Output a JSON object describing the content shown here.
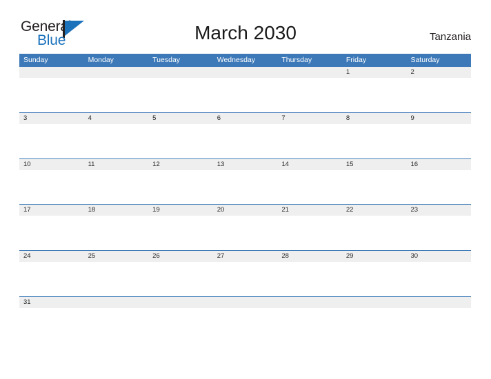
{
  "brand": {
    "name_part1": "General",
    "name_part2": "Blue",
    "mark": "flag-triangle"
  },
  "header": {
    "title": "March 2030",
    "locale": "Tanzania"
  },
  "colors": {
    "header_blue": "#3d79b8",
    "logo_blue": "#1b72bb",
    "daynum_band": "#efefef",
    "text": "#262626"
  },
  "calendar": {
    "month": "March",
    "year": "2030",
    "weekday_headers": [
      "Sunday",
      "Monday",
      "Tuesday",
      "Wednesday",
      "Thursday",
      "Friday",
      "Saturday"
    ],
    "weeks": [
      [
        "",
        "",
        "",
        "",
        "",
        "1",
        "2"
      ],
      [
        "3",
        "4",
        "5",
        "6",
        "7",
        "8",
        "9"
      ],
      [
        "10",
        "11",
        "12",
        "13",
        "14",
        "15",
        "16"
      ],
      [
        "17",
        "18",
        "19",
        "20",
        "21",
        "22",
        "23"
      ],
      [
        "24",
        "25",
        "26",
        "27",
        "28",
        "29",
        "30"
      ],
      [
        "31",
        "",
        "",
        "",
        "",
        "",
        ""
      ]
    ]
  }
}
